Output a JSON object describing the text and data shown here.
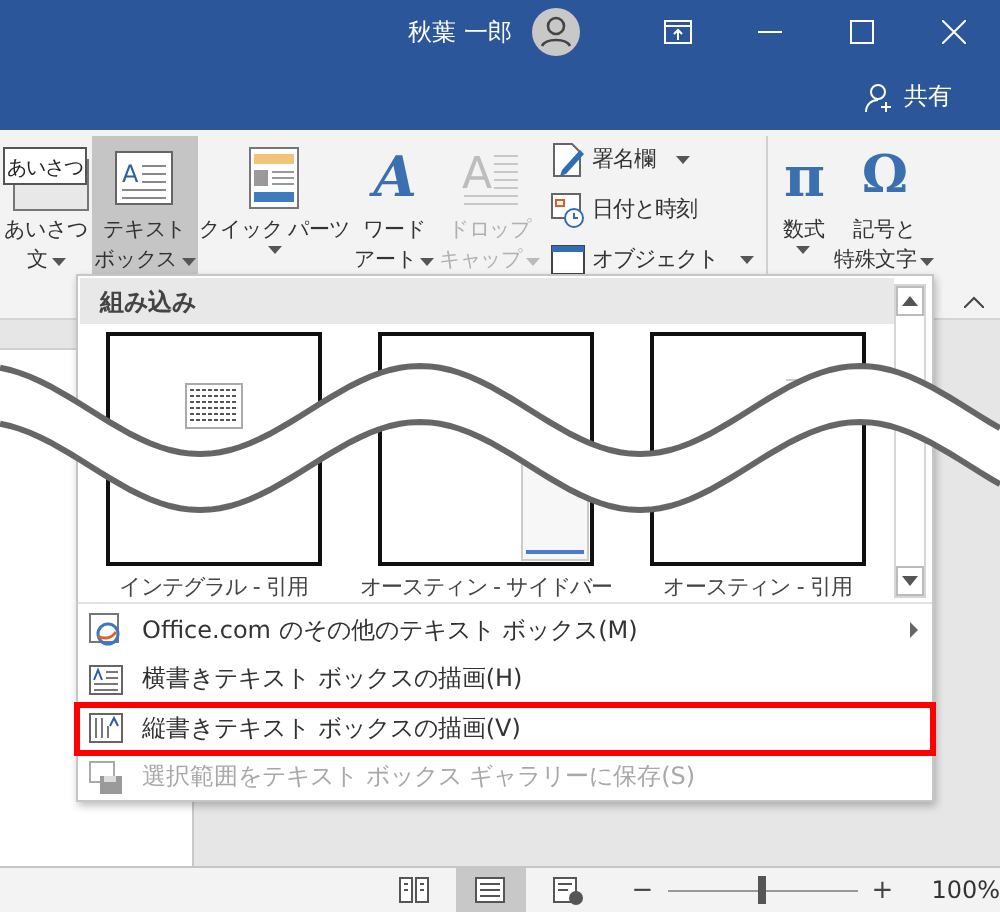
{
  "title_bar": {
    "user_name": "秋葉 一郎",
    "share": "共有"
  },
  "ribbon": {
    "items": [
      {
        "kind": "large",
        "icon_glyph": "あいさつ",
        "lines": [
          "あいさつ",
          "文"
        ],
        "caret": true,
        "selected": false,
        "disabled": false
      },
      {
        "kind": "large",
        "icon_glyph": "A",
        "lines": [
          "テキスト",
          "ボックス"
        ],
        "caret": true,
        "selected": true,
        "disabled": false
      },
      {
        "kind": "large",
        "lines": [
          "クイック パーツ"
        ],
        "caret": true,
        "selected": false,
        "disabled": false
      },
      {
        "kind": "large",
        "icon_glyph": "A",
        "lines": [
          "ワード",
          "アート"
        ],
        "caret": true,
        "selected": false,
        "disabled": false
      },
      {
        "kind": "large",
        "icon_glyph": "A",
        "lines": [
          "ドロップ",
          "キャップ"
        ],
        "caret": true,
        "selected": false,
        "disabled": true
      },
      {
        "kind": "small_group",
        "entries": [
          {
            "label": "署名欄",
            "caret": true
          },
          {
            "label": "日付と時刻",
            "caret": false
          },
          {
            "label": "オブジェクト",
            "caret": true
          }
        ]
      },
      {
        "kind": "separator"
      },
      {
        "kind": "large",
        "icon_glyph": "π",
        "lines": [
          "数式"
        ],
        "caret": true,
        "selected": false,
        "disabled": false
      },
      {
        "kind": "large",
        "icon_glyph": "Ω",
        "lines": [
          "記号と",
          "特殊文字"
        ],
        "caret": true,
        "selected": false,
        "disabled": false
      }
    ]
  },
  "dropdown": {
    "header": "組み込み",
    "gallery": [
      {
        "label": "インテグラル - 引用"
      },
      {
        "label": "オースティン - サイドバー"
      },
      {
        "label": "オースティン - 引用"
      }
    ],
    "menu": [
      {
        "label": "Office.com のその他のテキスト ボックス(M)",
        "submenu": true,
        "disabled": false,
        "highlighted": false
      },
      {
        "label": "横書きテキスト ボックスの描画(H)",
        "submenu": false,
        "disabled": false,
        "highlighted": false
      },
      {
        "label": "縦書きテキスト ボックスの描画(V)",
        "submenu": false,
        "disabled": false,
        "highlighted": true
      },
      {
        "label": "選択範囲をテキスト ボックス ギャラリーに保存(S)",
        "submenu": false,
        "disabled": true,
        "highlighted": false
      }
    ]
  },
  "status_bar": {
    "views": [
      {
        "selected": false
      },
      {
        "selected": true
      },
      {
        "selected": false
      }
    ],
    "zoom_out": "−",
    "zoom_in": "+",
    "zoom": {
      "level": 0.5
    },
    "zoom_text": "100%"
  }
}
